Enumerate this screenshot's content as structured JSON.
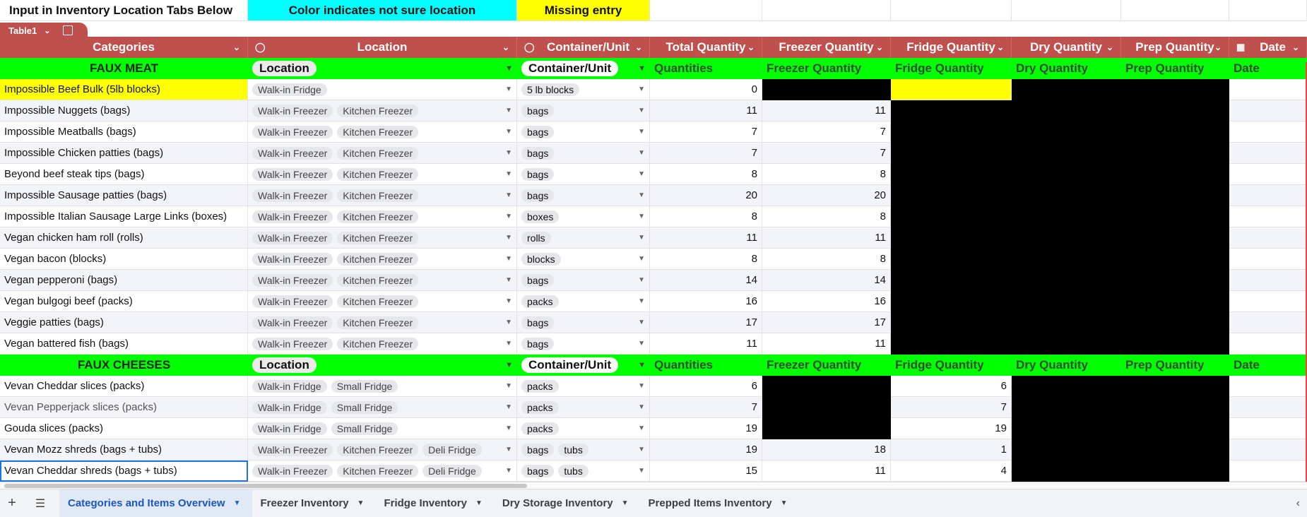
{
  "banner": {
    "instruction": "Input in Inventory Location Tabs Below",
    "legend_cyan": "Color indicates not sure location",
    "legend_yellow": "Missing entry"
  },
  "table_tab": {
    "label": "Table1"
  },
  "columns": [
    "Categories",
    "Location",
    "Container/Unit",
    "Total Quantity",
    "Freezer Quantity",
    "Fridge Quantity",
    "Dry Quantity",
    "Prep Quantity",
    "Date"
  ],
  "sections": {
    "meat": {
      "title": "FAUX MEAT",
      "location": "Location",
      "unit": "Container/Unit",
      "quantities": "Quantities",
      "freezer": "Freezer Quantity",
      "fridge": "Fridge Quantity",
      "dry": "Dry Quantity",
      "prep": "Prep Quantity",
      "date": "Date"
    },
    "cheese": {
      "title": "FAUX CHEESES",
      "location": "Location",
      "unit": "Container/Unit",
      "quantities": "Quantities",
      "freezer": "Freezer Quantity",
      "fridge": "Fridge Quantity",
      "dry": "Dry Quantity",
      "prep": "Prep Quantity",
      "date": "Date"
    }
  },
  "meat_rows": [
    {
      "name": "Impossible Beef Bulk (5lb blocks)",
      "loc": [
        "Walk-in Fridge"
      ],
      "unit": [
        "5 lb blocks"
      ],
      "total": "0",
      "freezer": "",
      "fridge": ""
    },
    {
      "name": "Impossible Nuggets (bags)",
      "loc": [
        "Walk-in Freezer",
        "Kitchen Freezer"
      ],
      "unit": [
        "bags"
      ],
      "total": "11",
      "freezer": "11",
      "fridge": ""
    },
    {
      "name": "Impossible Meatballs (bags)",
      "loc": [
        "Walk-in Freezer",
        "Kitchen Freezer"
      ],
      "unit": [
        "bags"
      ],
      "total": "7",
      "freezer": "7",
      "fridge": ""
    },
    {
      "name": "Impossible Chicken patties (bags)",
      "loc": [
        "Walk-in Freezer",
        "Kitchen Freezer"
      ],
      "unit": [
        "bags"
      ],
      "total": "7",
      "freezer": "7",
      "fridge": ""
    },
    {
      "name": "Beyond beef steak tips (bags)",
      "loc": [
        "Walk-in Freezer",
        "Kitchen Freezer"
      ],
      "unit": [
        "bags"
      ],
      "total": "8",
      "freezer": "8",
      "fridge": ""
    },
    {
      "name": "Impossible Sausage patties (bags)",
      "loc": [
        "Walk-in Freezer",
        "Kitchen Freezer"
      ],
      "unit": [
        "bags"
      ],
      "total": "20",
      "freezer": "20",
      "fridge": ""
    },
    {
      "name": "Impossible Italian Sausage Large Links (boxes)",
      "loc": [
        "Walk-in Freezer",
        "Kitchen Freezer"
      ],
      "unit": [
        "boxes"
      ],
      "total": "8",
      "freezer": "8",
      "fridge": ""
    },
    {
      "name": "Vegan chicken ham roll (rolls)",
      "loc": [
        "Walk-in Freezer",
        "Kitchen Freezer"
      ],
      "unit": [
        "rolls"
      ],
      "total": "11",
      "freezer": "11",
      "fridge": ""
    },
    {
      "name": "Vegan bacon (blocks)",
      "loc": [
        "Walk-in Freezer",
        "Kitchen Freezer"
      ],
      "unit": [
        "blocks"
      ],
      "total": "8",
      "freezer": "8",
      "fridge": ""
    },
    {
      "name": "Vegan pepperoni (bags)",
      "loc": [
        "Walk-in Freezer",
        "Kitchen Freezer"
      ],
      "unit": [
        "bags"
      ],
      "total": "14",
      "freezer": "14",
      "fridge": ""
    },
    {
      "name": "Vegan bulgogi beef (packs)",
      "loc": [
        "Walk-in Freezer",
        "Kitchen Freezer"
      ],
      "unit": [
        "packs"
      ],
      "total": "16",
      "freezer": "16",
      "fridge": ""
    },
    {
      "name": "Veggie patties (bags)",
      "loc": [
        "Walk-in Freezer",
        "Kitchen Freezer"
      ],
      "unit": [
        "bags"
      ],
      "total": "17",
      "freezer": "17",
      "fridge": ""
    },
    {
      "name": "Vegan battered fish (bags)",
      "loc": [
        "Walk-in Freezer",
        "Kitchen Freezer"
      ],
      "unit": [
        "bags"
      ],
      "total": "11",
      "freezer": "11",
      "fridge": ""
    }
  ],
  "cheese_rows": [
    {
      "name": "Vevan Cheddar slices (packs)",
      "loc": [
        "Walk-in Fridge",
        "Small Fridge"
      ],
      "unit": [
        "packs"
      ],
      "total": "6",
      "freezer": "",
      "fridge": "6"
    },
    {
      "name": "Vevan Pepperjack slices (packs)",
      "loc": [
        "Walk-in Fridge",
        "Small Fridge"
      ],
      "unit": [
        "packs"
      ],
      "total": "7",
      "freezer": "",
      "fridge": "7"
    },
    {
      "name": "Gouda slices (packs)",
      "loc": [
        "Walk-in Fridge",
        "Small Fridge"
      ],
      "unit": [
        "packs"
      ],
      "total": "19",
      "freezer": "",
      "fridge": "19"
    },
    {
      "name": "Vevan Mozz shreds (bags + tubs)",
      "loc": [
        "Walk-in Freezer",
        "Kitchen Freezer",
        "Deli Fridge"
      ],
      "unit": [
        "bags",
        "tubs"
      ],
      "total": "19",
      "freezer": "18",
      "fridge": "1"
    },
    {
      "name": "Vevan Cheddar shreds (bags + tubs)",
      "loc": [
        "Walk-in Freezer",
        "Kitchen Freezer",
        "Deli Fridge"
      ],
      "unit": [
        "bags",
        "tubs"
      ],
      "total": "15",
      "freezer": "11",
      "fridge": "4"
    }
  ],
  "sheet_tabs": [
    "Categories and Items Overview",
    "Freezer Inventory",
    "Fridge Inventory",
    "Dry Storage Inventory",
    "Prepped Items Inventory"
  ],
  "colors": {
    "header": "#c0504d",
    "section": "#00ff00",
    "cyan": "#00ffff",
    "yellow": "#ffff00",
    "active_tab": "#1a56c6"
  },
  "icons": {
    "add_sheet": "plus-icon",
    "all_sheets": "menu-icon",
    "scroll_left": "chevron-left-icon"
  }
}
